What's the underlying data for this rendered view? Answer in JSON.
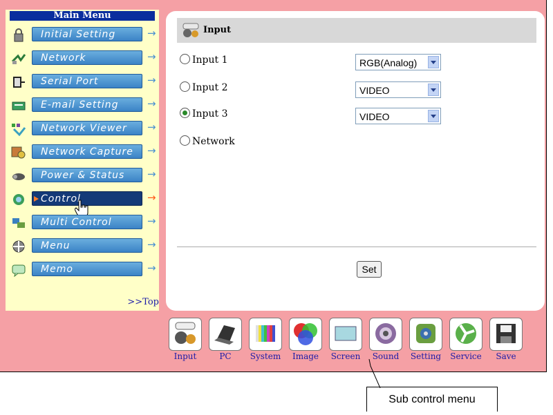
{
  "menu": {
    "title": "Main Menu",
    "items": [
      {
        "label": "Initial Setting",
        "icon": "lock-icon"
      },
      {
        "label": "Network",
        "icon": "network-icon"
      },
      {
        "label": "Serial Port",
        "icon": "serial-port-icon"
      },
      {
        "label": "E-mail Setting",
        "icon": "email-icon"
      },
      {
        "label": "Network Viewer",
        "icon": "network-viewer-icon"
      },
      {
        "label": "Network Capture",
        "icon": "network-capture-icon"
      },
      {
        "label": "Power & Status",
        "icon": "projector-icon"
      },
      {
        "label": "Control",
        "icon": "control-icon",
        "active": true
      },
      {
        "label": "Multi Control",
        "icon": "multi-control-icon"
      },
      {
        "label": "Menu",
        "icon": "menu-icon"
      },
      {
        "label": "Memo",
        "icon": "memo-icon"
      }
    ],
    "top_link": ">>Top"
  },
  "panel": {
    "title": "Input",
    "inputs": [
      {
        "label": "Input 1",
        "selected": false,
        "value": "RGB(Analog)"
      },
      {
        "label": "Input 2",
        "selected": false,
        "value": "VIDEO"
      },
      {
        "label": "Input 3",
        "selected": true,
        "value": "VIDEO"
      },
      {
        "label": "Network",
        "selected": false,
        "value": ""
      }
    ],
    "set_label": "Set"
  },
  "submenu": [
    {
      "label": "Input",
      "icon": "input-icon"
    },
    {
      "label": "PC",
      "icon": "pc-icon"
    },
    {
      "label": "System",
      "icon": "system-icon"
    },
    {
      "label": "Image",
      "icon": "image-icon"
    },
    {
      "label": "Screen",
      "icon": "screen-icon"
    },
    {
      "label": "Sound",
      "icon": "sound-icon"
    },
    {
      "label": "Setting",
      "icon": "setting-icon"
    },
    {
      "label": "Service",
      "icon": "service-icon"
    },
    {
      "label": "Save",
      "icon": "save-icon"
    }
  ],
  "callout": "Sub control menu"
}
